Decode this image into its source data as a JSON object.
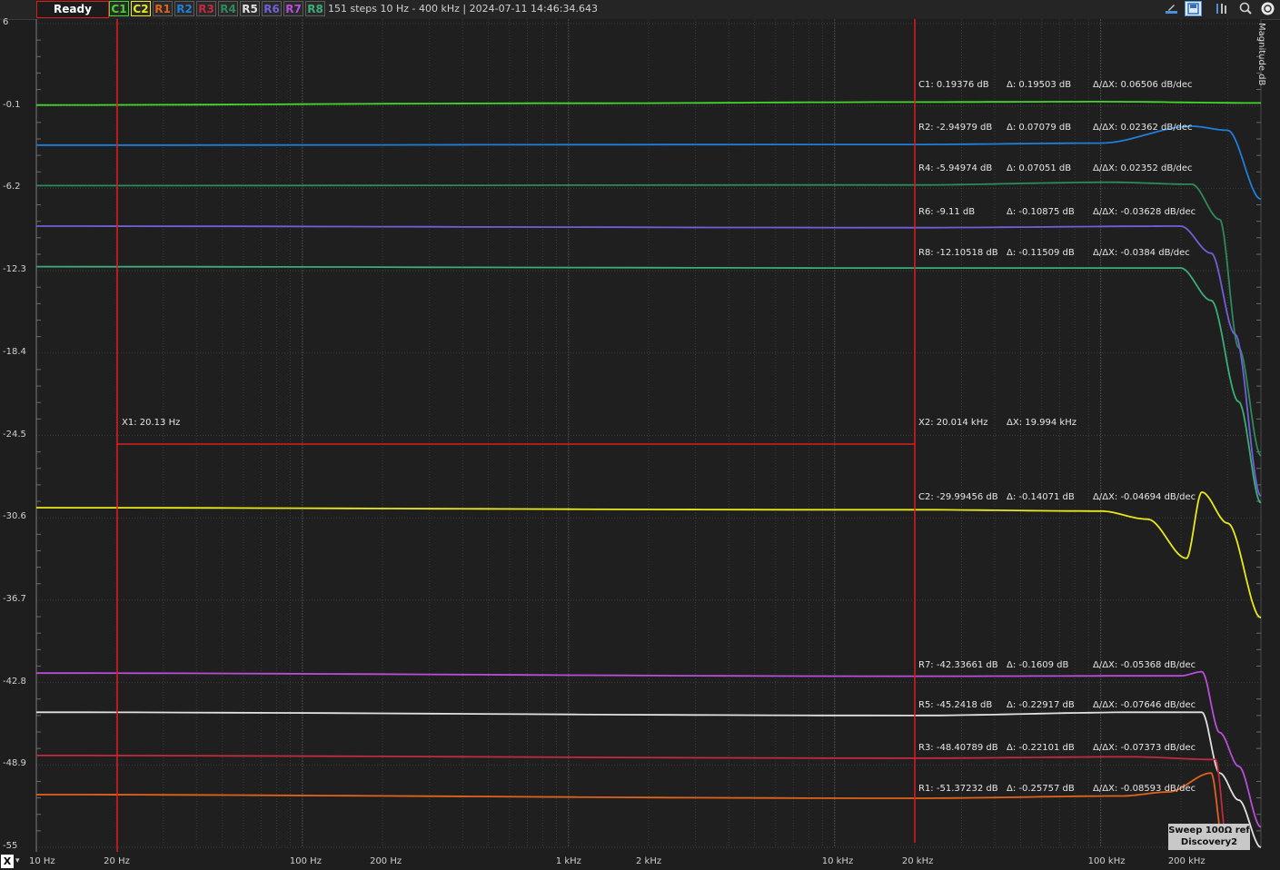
{
  "toolbar": {
    "status": "Ready",
    "channels": [
      {
        "label": "C1",
        "color": "#44d62c"
      },
      {
        "label": "C2",
        "color": "#e8e81a"
      },
      {
        "label": "R1",
        "color": "#e0631c"
      },
      {
        "label": "R2",
        "color": "#1f7fd8"
      },
      {
        "label": "R3",
        "color": "#c22a3e"
      },
      {
        "label": "R4",
        "color": "#2e8a5a"
      },
      {
        "label": "R5",
        "color": "#e0e0e0"
      },
      {
        "label": "R6",
        "color": "#7060d8"
      },
      {
        "label": "R7",
        "color": "#b84ed8"
      },
      {
        "label": "R8",
        "color": "#3cac78"
      }
    ],
    "sweep_info": "151 steps   10 Hz - 400 kHz | 2024-07-11 14:46:34.643",
    "icons": [
      "export-icon",
      "save-icon",
      "settings-icon",
      "zoom-icon",
      "camera-icon"
    ]
  },
  "plot": {
    "y_axis_title": "Magnitude  dB",
    "y_ticks": [
      "6",
      "-0.1",
      "-6.2",
      "-12.3",
      "-18.4",
      "-24.5",
      "-30.6",
      "-36.7",
      "-42.8",
      "-48.9",
      "-55"
    ],
    "x_ticks": [
      "10 Hz",
      "20 Hz",
      "100 Hz",
      "200 Hz",
      "1 kHz",
      "2 kHz",
      "10 kHz",
      "20 kHz",
      "100 kHz",
      "200 kHz"
    ]
  },
  "cursors": {
    "x1_label": "X1: 20.13 Hz",
    "x2_label": "X2: 20.014 kHz",
    "dx_label": "ΔX: 19.994 kHz"
  },
  "readouts": [
    {
      "name": "C1",
      "value": "C1: 0.19376 dB",
      "delta": "Δ: 0.19503 dB",
      "slope": "Δ/ΔX: 0.06506 dB/dec"
    },
    {
      "name": "R2",
      "value": "R2: -2.94979 dB",
      "delta": "Δ: 0.07079 dB",
      "slope": "Δ/ΔX: 0.02362 dB/dec"
    },
    {
      "name": "R4",
      "value": "R4: -5.94974 dB",
      "delta": "Δ: 0.07051 dB",
      "slope": "Δ/ΔX: 0.02352 dB/dec"
    },
    {
      "name": "R6",
      "value": "R6: -9.11 dB",
      "delta": "Δ: -0.10875 dB",
      "slope": "Δ/ΔX: -0.03628 dB/dec"
    },
    {
      "name": "R8",
      "value": "R8: -12.10518 dB",
      "delta": "Δ: -0.11509 dB",
      "slope": "Δ/ΔX: -0.0384 dB/dec"
    },
    {
      "name": "C2",
      "value": "C2: -29.99456 dB",
      "delta": "Δ: -0.14071 dB",
      "slope": "Δ/ΔX: -0.04694 dB/dec"
    },
    {
      "name": "R7",
      "value": "R7: -42.33661 dB",
      "delta": "Δ: -0.1609 dB",
      "slope": "Δ/ΔX: -0.05368 dB/dec"
    },
    {
      "name": "R5",
      "value": "R5: -45.2418 dB",
      "delta": "Δ: -0.22917 dB",
      "slope": "Δ/ΔX: -0.07646 dB/dec"
    },
    {
      "name": "R3",
      "value": "R3: -48.40789 dB",
      "delta": "Δ: -0.22101 dB",
      "slope": "Δ/ΔX: -0.07373 dB/dec"
    },
    {
      "name": "R1",
      "value": "R1: -51.37232 dB",
      "delta": "Δ: -0.25757 dB",
      "slope": "Δ/ΔX: -0.08593 dB/dec"
    }
  ],
  "bottom": {
    "x_button": "X",
    "x_button_arrow": "▾",
    "device_line1": "Sweep 100Ω ref",
    "device_line2": "Discovery2"
  },
  "chart_data": {
    "type": "line",
    "x_scale": "log",
    "xlim": [
      10,
      400000
    ],
    "ylim": [
      -55,
      6
    ],
    "grid": true,
    "cursors": {
      "x1": 20.13,
      "x2": 20014
    },
    "series": [
      {
        "name": "C1",
        "color": "#44d62c",
        "points": [
          [
            10,
            -0.03
          ],
          [
            1000,
            0.1
          ],
          [
            20000,
            0.19
          ],
          [
            100000,
            0.22
          ],
          [
            400000,
            0.12
          ]
        ]
      },
      {
        "name": "R2",
        "color": "#1f7fd8",
        "points": [
          [
            10,
            -3.0
          ],
          [
            20000,
            -2.95
          ],
          [
            100000,
            -2.85
          ],
          [
            220000,
            -1.6
          ],
          [
            300000,
            -1.9
          ],
          [
            400000,
            -7.0
          ]
        ]
      },
      {
        "name": "R4",
        "color": "#2e8a5a",
        "points": [
          [
            10,
            -6.0
          ],
          [
            20000,
            -5.95
          ],
          [
            110000,
            -5.75
          ],
          [
            220000,
            -5.9
          ],
          [
            280000,
            -8.5
          ],
          [
            330000,
            -18
          ],
          [
            400000,
            -26.0
          ]
        ]
      },
      {
        "name": "R6",
        "color": "#7060d8",
        "points": [
          [
            10,
            -9.0
          ],
          [
            20000,
            -9.11
          ],
          [
            200000,
            -9.0
          ],
          [
            260000,
            -11.0
          ],
          [
            320000,
            -17.0
          ],
          [
            400000,
            -29.0
          ]
        ]
      },
      {
        "name": "R8",
        "color": "#3cac78",
        "points": [
          [
            10,
            -12.0
          ],
          [
            20000,
            -12.1
          ],
          [
            200000,
            -12.1
          ],
          [
            260000,
            -14.5
          ],
          [
            330000,
            -22.0
          ],
          [
            400000,
            -29.5
          ]
        ]
      },
      {
        "name": "C2",
        "color": "#e8e81a",
        "points": [
          [
            10,
            -29.85
          ],
          [
            10000,
            -30.0
          ],
          [
            20000,
            -30.0
          ],
          [
            100000,
            -30.1
          ],
          [
            150000,
            -30.7
          ],
          [
            210000,
            -33.6
          ],
          [
            240000,
            -28.7
          ],
          [
            300000,
            -31.0
          ],
          [
            400000,
            -38.0
          ]
        ]
      },
      {
        "name": "R7",
        "color": "#b84ed8",
        "points": [
          [
            10,
            -42.1
          ],
          [
            20000,
            -42.33
          ],
          [
            200000,
            -42.3
          ],
          [
            240000,
            -42.0
          ],
          [
            280000,
            -46.5
          ],
          [
            330000,
            -49.0
          ],
          [
            400000,
            -53.5
          ]
        ]
      },
      {
        "name": "R5",
        "color": "#e0e0e0",
        "points": [
          [
            10,
            -45.0
          ],
          [
            20000,
            -45.24
          ],
          [
            140000,
            -45.0
          ],
          [
            240000,
            -45.0
          ],
          [
            280000,
            -49.5
          ],
          [
            330000,
            -51.5
          ],
          [
            400000,
            -55.0
          ]
        ]
      },
      {
        "name": "R3",
        "color": "#c22a3e",
        "points": [
          [
            10,
            -48.2
          ],
          [
            20000,
            -48.4
          ],
          [
            130000,
            -48.3
          ],
          [
            270000,
            -48.5
          ],
          [
            300000,
            -55.0
          ]
        ]
      },
      {
        "name": "R1",
        "color": "#e0631c",
        "points": [
          [
            10,
            -51.1
          ],
          [
            20000,
            -51.37
          ],
          [
            120000,
            -51.2
          ],
          [
            180000,
            -50.9
          ],
          [
            260000,
            -49.5
          ],
          [
            290000,
            -55.0
          ]
        ]
      }
    ]
  }
}
